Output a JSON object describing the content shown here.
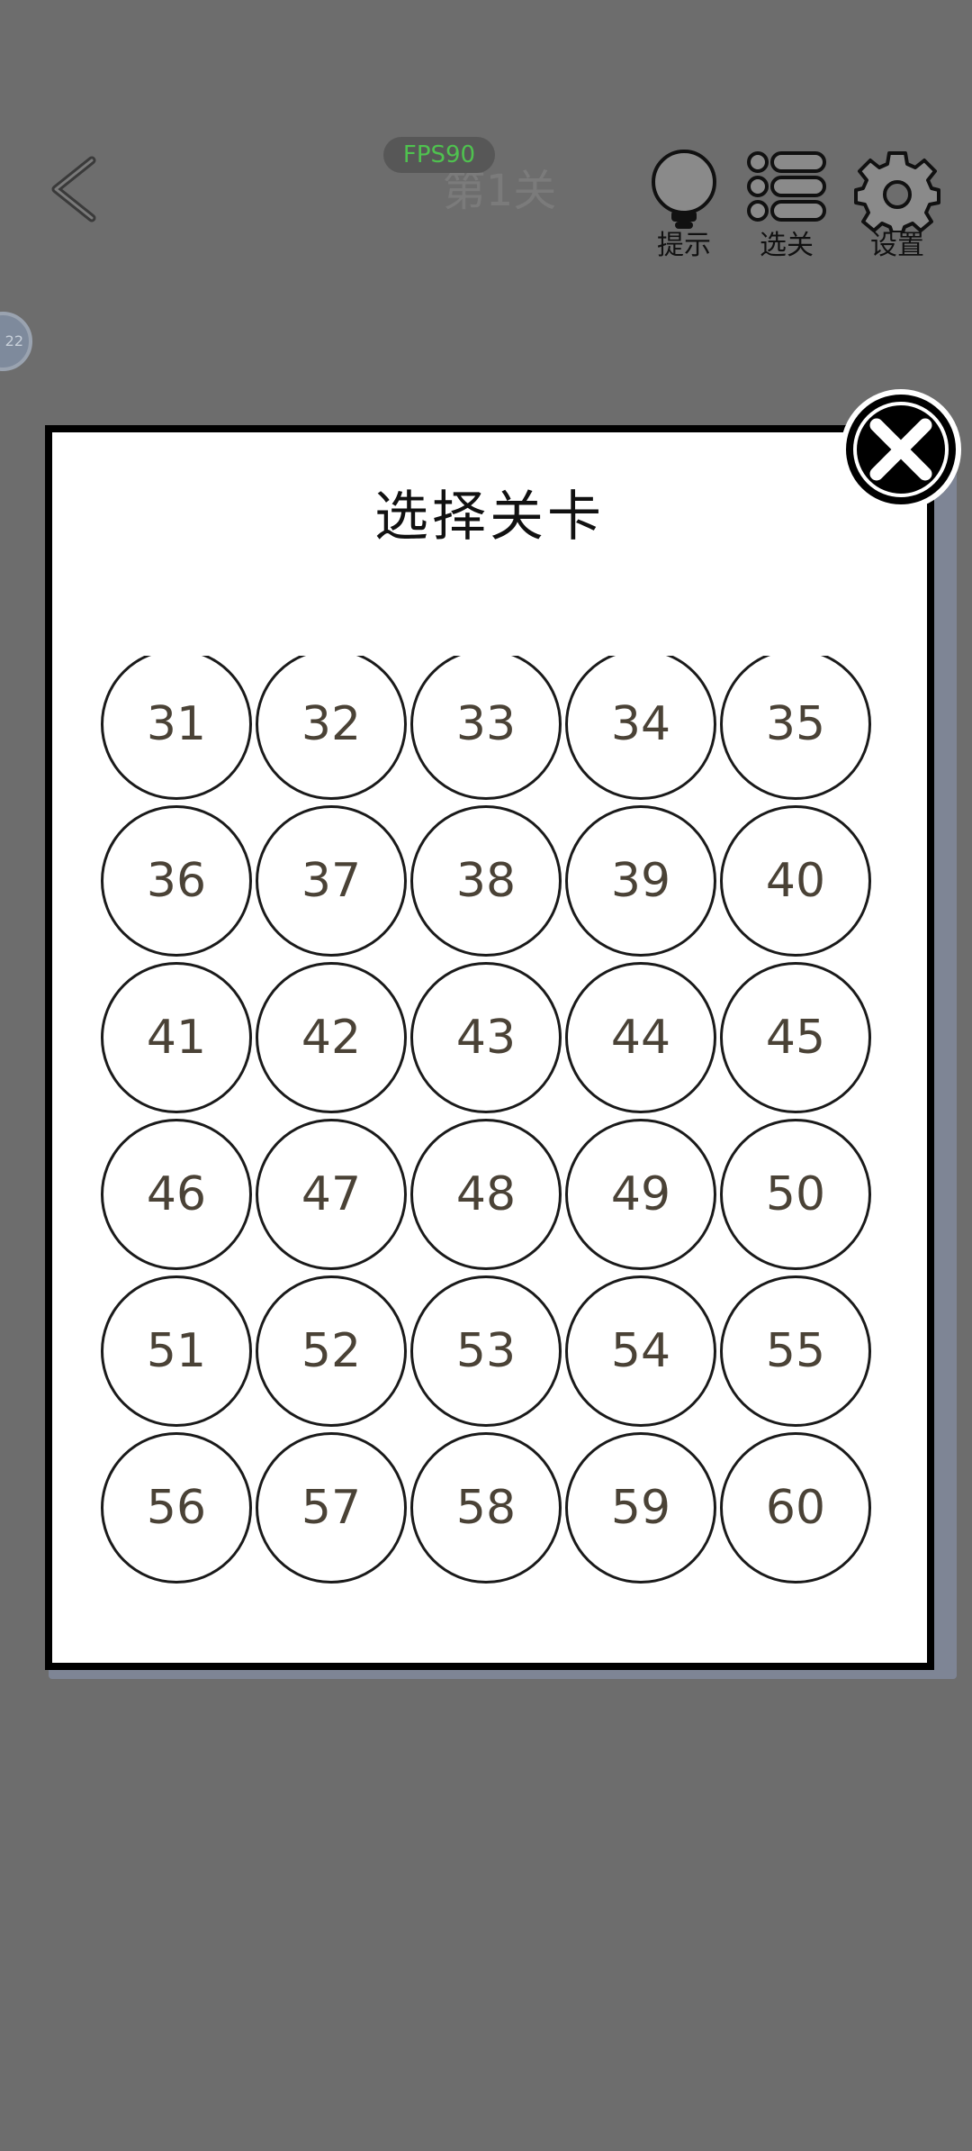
{
  "header": {
    "fps_label": "FPS90",
    "level_title": "第1关",
    "hint_label": "提示",
    "select_label": "选关",
    "settings_label": "设置"
  },
  "side_badge": "22",
  "modal": {
    "title": "选择关卡",
    "levels": [
      "31",
      "32",
      "33",
      "34",
      "35",
      "36",
      "37",
      "38",
      "39",
      "40",
      "41",
      "42",
      "43",
      "44",
      "45",
      "46",
      "47",
      "48",
      "49",
      "50",
      "51",
      "52",
      "53",
      "54",
      "55",
      "56",
      "57",
      "58",
      "59",
      "60"
    ]
  },
  "colors": {
    "background": "#6d6d6d",
    "fps_text": "#4fc24f",
    "level_text": "#4a4236"
  },
  "icons": [
    "back-arrow-icon",
    "lightbulb-icon",
    "level-list-icon",
    "gear-icon",
    "close-icon"
  ]
}
